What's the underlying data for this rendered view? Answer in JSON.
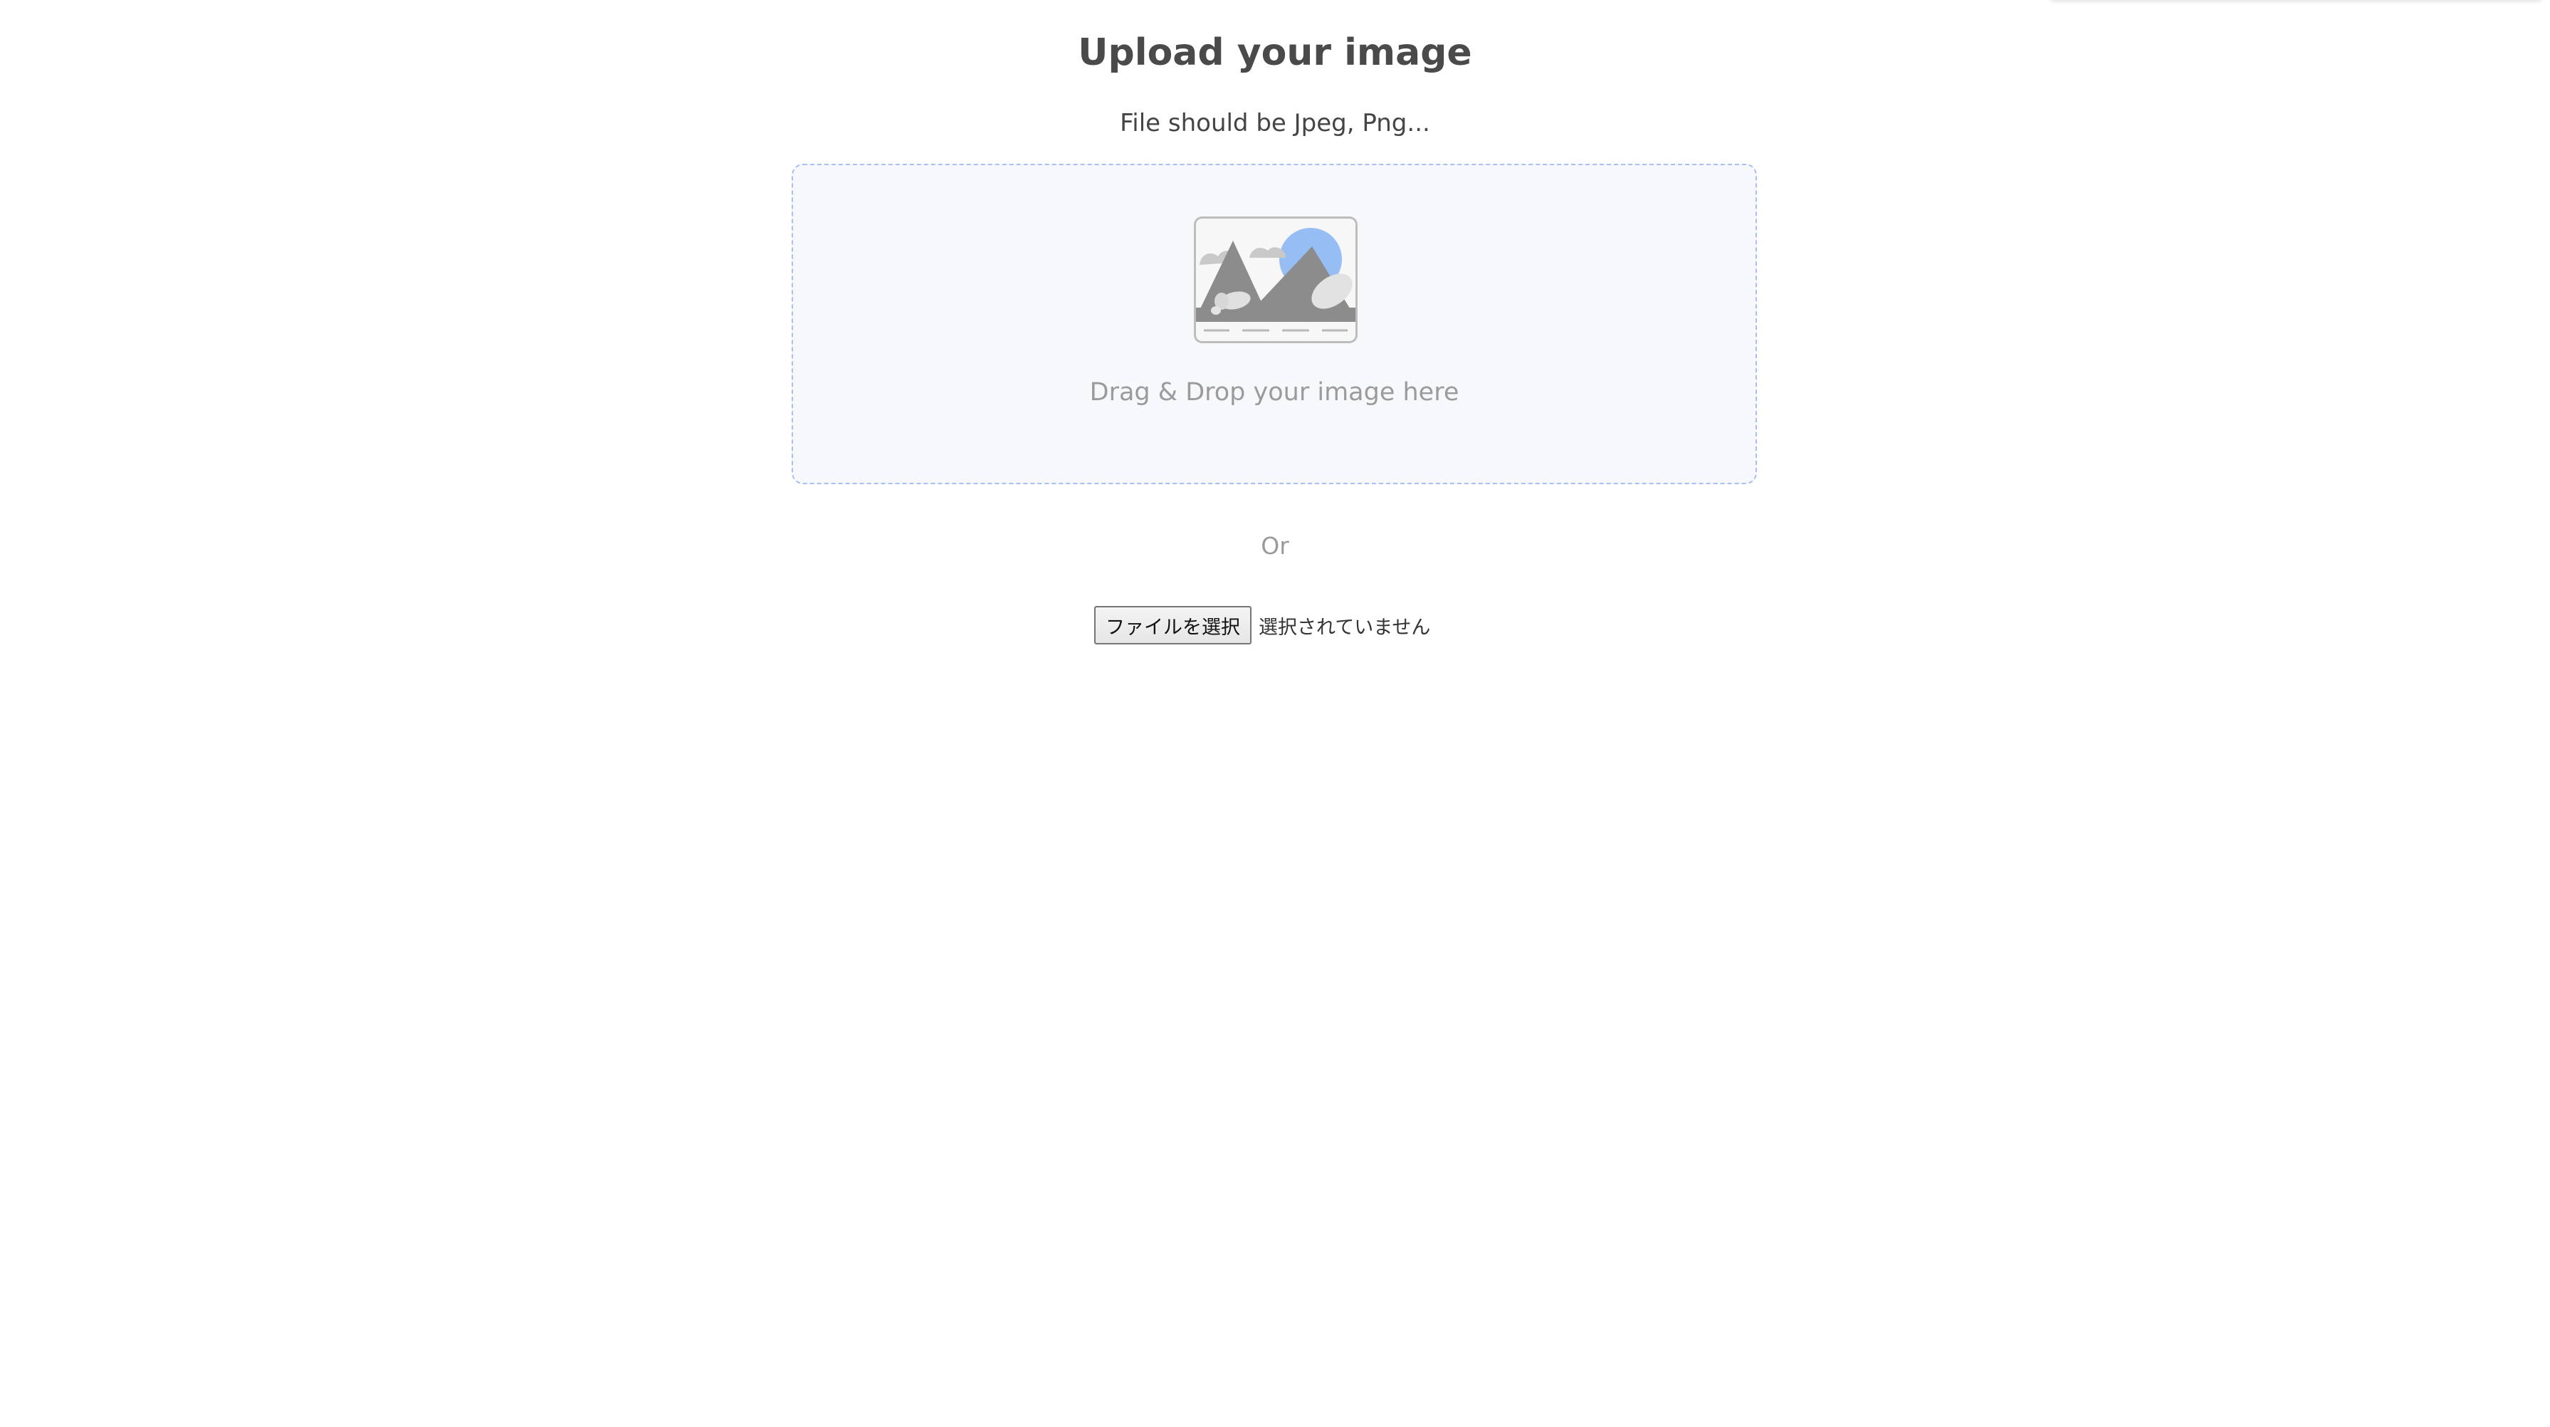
{
  "header": {
    "title": "Upload your image",
    "subtitle": "File should be Jpeg, Png..."
  },
  "dropzone": {
    "text": "Drag & Drop your image here",
    "icon": "image-placeholder-icon"
  },
  "divider": {
    "text": "Or"
  },
  "file_input": {
    "button_label": "ファイルを選択",
    "status_text": "選択されていません"
  },
  "colors": {
    "title": "#4a4a4a",
    "dropzone_border": "#a9bff3",
    "dropzone_background": "#f7f8fb",
    "muted_text": "#9b9b9b",
    "sun_accent": "#97bef4"
  }
}
